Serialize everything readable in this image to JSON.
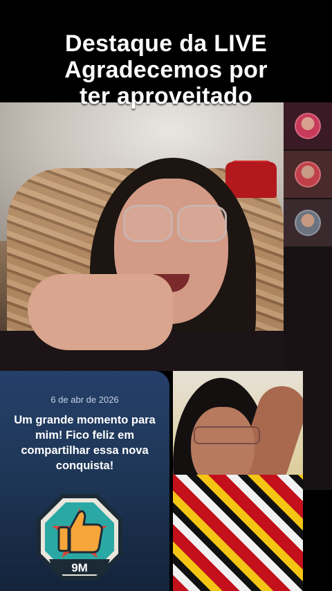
{
  "headline": {
    "line1": "Destaque da LIVE",
    "line2": "Agradecemos por",
    "line3": "ter aproveitado"
  },
  "milestone_card": {
    "date": "6 de abr de 2026",
    "message": "Um grande momento para mim! Fico feliz em compartilhar essa nova conquista!",
    "badge_value": "9M",
    "badge_icon": "thumbs-up-icon",
    "badge_colors": {
      "ring": "#1c2a36",
      "accent_teal": "#2aa9a4",
      "accent_red": "#d9453b",
      "thumb": "#f5a53a"
    }
  },
  "guests": [
    {
      "avatar": "guest-avatar-1",
      "color": "#c83a5a"
    },
    {
      "avatar": "guest-avatar-2",
      "color": "#c0404a"
    },
    {
      "avatar": "guest-avatar-3",
      "color": "#6c7380"
    }
  ]
}
